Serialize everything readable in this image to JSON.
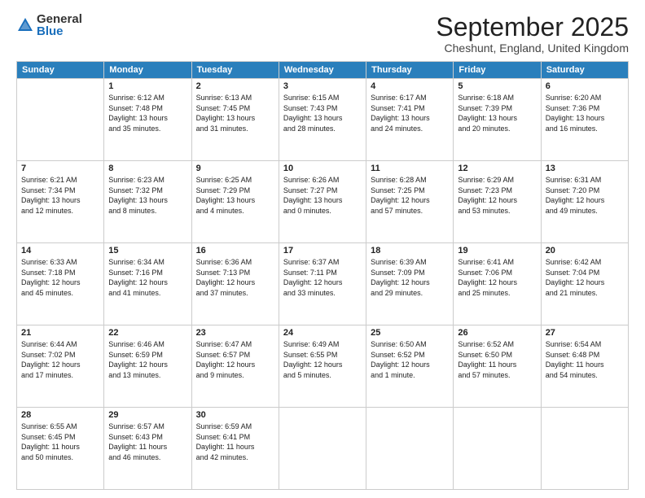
{
  "logo": {
    "general": "General",
    "blue": "Blue"
  },
  "header": {
    "month": "September 2025",
    "location": "Cheshunt, England, United Kingdom"
  },
  "days_of_week": [
    "Sunday",
    "Monday",
    "Tuesday",
    "Wednesday",
    "Thursday",
    "Friday",
    "Saturday"
  ],
  "weeks": [
    [
      {
        "day": "",
        "info": ""
      },
      {
        "day": "1",
        "info": "Sunrise: 6:12 AM\nSunset: 7:48 PM\nDaylight: 13 hours\nand 35 minutes."
      },
      {
        "day": "2",
        "info": "Sunrise: 6:13 AM\nSunset: 7:45 PM\nDaylight: 13 hours\nand 31 minutes."
      },
      {
        "day": "3",
        "info": "Sunrise: 6:15 AM\nSunset: 7:43 PM\nDaylight: 13 hours\nand 28 minutes."
      },
      {
        "day": "4",
        "info": "Sunrise: 6:17 AM\nSunset: 7:41 PM\nDaylight: 13 hours\nand 24 minutes."
      },
      {
        "day": "5",
        "info": "Sunrise: 6:18 AM\nSunset: 7:39 PM\nDaylight: 13 hours\nand 20 minutes."
      },
      {
        "day": "6",
        "info": "Sunrise: 6:20 AM\nSunset: 7:36 PM\nDaylight: 13 hours\nand 16 minutes."
      }
    ],
    [
      {
        "day": "7",
        "info": "Sunrise: 6:21 AM\nSunset: 7:34 PM\nDaylight: 13 hours\nand 12 minutes."
      },
      {
        "day": "8",
        "info": "Sunrise: 6:23 AM\nSunset: 7:32 PM\nDaylight: 13 hours\nand 8 minutes."
      },
      {
        "day": "9",
        "info": "Sunrise: 6:25 AM\nSunset: 7:29 PM\nDaylight: 13 hours\nand 4 minutes."
      },
      {
        "day": "10",
        "info": "Sunrise: 6:26 AM\nSunset: 7:27 PM\nDaylight: 13 hours\nand 0 minutes."
      },
      {
        "day": "11",
        "info": "Sunrise: 6:28 AM\nSunset: 7:25 PM\nDaylight: 12 hours\nand 57 minutes."
      },
      {
        "day": "12",
        "info": "Sunrise: 6:29 AM\nSunset: 7:23 PM\nDaylight: 12 hours\nand 53 minutes."
      },
      {
        "day": "13",
        "info": "Sunrise: 6:31 AM\nSunset: 7:20 PM\nDaylight: 12 hours\nand 49 minutes."
      }
    ],
    [
      {
        "day": "14",
        "info": "Sunrise: 6:33 AM\nSunset: 7:18 PM\nDaylight: 12 hours\nand 45 minutes."
      },
      {
        "day": "15",
        "info": "Sunrise: 6:34 AM\nSunset: 7:16 PM\nDaylight: 12 hours\nand 41 minutes."
      },
      {
        "day": "16",
        "info": "Sunrise: 6:36 AM\nSunset: 7:13 PM\nDaylight: 12 hours\nand 37 minutes."
      },
      {
        "day": "17",
        "info": "Sunrise: 6:37 AM\nSunset: 7:11 PM\nDaylight: 12 hours\nand 33 minutes."
      },
      {
        "day": "18",
        "info": "Sunrise: 6:39 AM\nSunset: 7:09 PM\nDaylight: 12 hours\nand 29 minutes."
      },
      {
        "day": "19",
        "info": "Sunrise: 6:41 AM\nSunset: 7:06 PM\nDaylight: 12 hours\nand 25 minutes."
      },
      {
        "day": "20",
        "info": "Sunrise: 6:42 AM\nSunset: 7:04 PM\nDaylight: 12 hours\nand 21 minutes."
      }
    ],
    [
      {
        "day": "21",
        "info": "Sunrise: 6:44 AM\nSunset: 7:02 PM\nDaylight: 12 hours\nand 17 minutes."
      },
      {
        "day": "22",
        "info": "Sunrise: 6:46 AM\nSunset: 6:59 PM\nDaylight: 12 hours\nand 13 minutes."
      },
      {
        "day": "23",
        "info": "Sunrise: 6:47 AM\nSunset: 6:57 PM\nDaylight: 12 hours\nand 9 minutes."
      },
      {
        "day": "24",
        "info": "Sunrise: 6:49 AM\nSunset: 6:55 PM\nDaylight: 12 hours\nand 5 minutes."
      },
      {
        "day": "25",
        "info": "Sunrise: 6:50 AM\nSunset: 6:52 PM\nDaylight: 12 hours\nand 1 minute."
      },
      {
        "day": "26",
        "info": "Sunrise: 6:52 AM\nSunset: 6:50 PM\nDaylight: 11 hours\nand 57 minutes."
      },
      {
        "day": "27",
        "info": "Sunrise: 6:54 AM\nSunset: 6:48 PM\nDaylight: 11 hours\nand 54 minutes."
      }
    ],
    [
      {
        "day": "28",
        "info": "Sunrise: 6:55 AM\nSunset: 6:45 PM\nDaylight: 11 hours\nand 50 minutes."
      },
      {
        "day": "29",
        "info": "Sunrise: 6:57 AM\nSunset: 6:43 PM\nDaylight: 11 hours\nand 46 minutes."
      },
      {
        "day": "30",
        "info": "Sunrise: 6:59 AM\nSunset: 6:41 PM\nDaylight: 11 hours\nand 42 minutes."
      },
      {
        "day": "",
        "info": ""
      },
      {
        "day": "",
        "info": ""
      },
      {
        "day": "",
        "info": ""
      },
      {
        "day": "",
        "info": ""
      }
    ]
  ]
}
